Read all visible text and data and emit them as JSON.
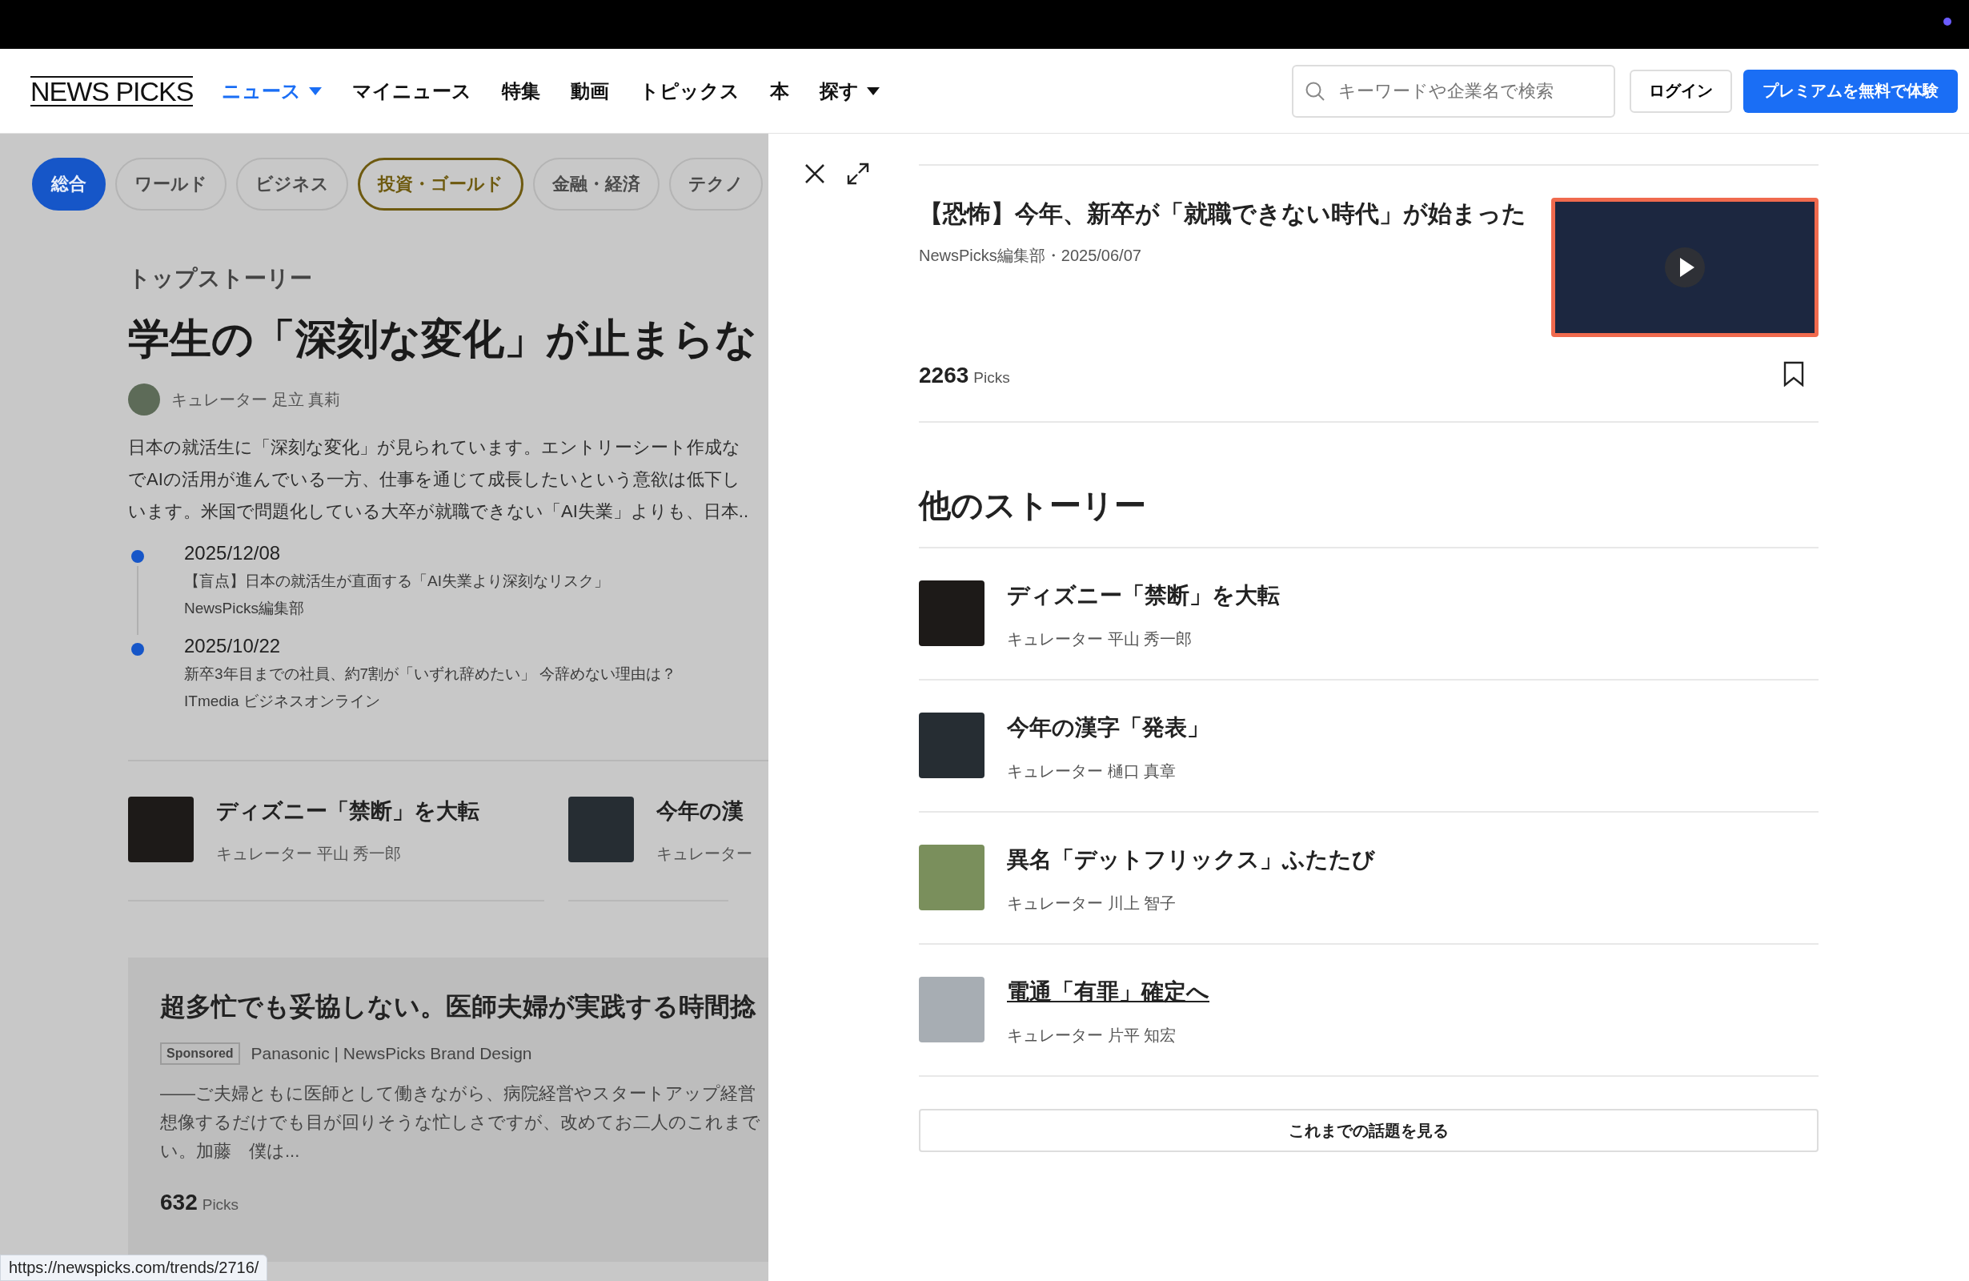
{
  "header": {
    "logo": "NEWS PICKS",
    "nav": [
      {
        "label": "ニュース",
        "selected": true,
        "dropdown": true
      },
      {
        "label": "マイニュース",
        "selected": false,
        "dropdown": false
      },
      {
        "label": "特集",
        "selected": false,
        "dropdown": false
      },
      {
        "label": "動画",
        "selected": false,
        "dropdown": false
      },
      {
        "label": "トピックス",
        "selected": false,
        "dropdown": false
      },
      {
        "label": "本",
        "selected": false,
        "dropdown": false
      },
      {
        "label": "探す",
        "selected": false,
        "dropdown": true
      }
    ],
    "search": {
      "placeholder": "キーワードや企業名で検索"
    },
    "login": "ログイン",
    "premium": "プレミアムを無料で体験"
  },
  "categories": [
    {
      "label": "総合",
      "selected": true,
      "highlighted": false
    },
    {
      "label": "ワールド",
      "selected": false,
      "highlighted": false
    },
    {
      "label": "ビジネス",
      "selected": false,
      "highlighted": false
    },
    {
      "label": "投資・ゴールド",
      "selected": false,
      "highlighted": true
    },
    {
      "label": "金融・経済",
      "selected": false,
      "highlighted": false
    },
    {
      "label": "テクノ",
      "selected": false,
      "highlighted": false
    }
  ],
  "top_story": {
    "section": "トップストーリー",
    "headline": "学生の「深刻な変化」が止まらな",
    "curator": "キュレーター 足立 真莉",
    "lines": [
      "日本の就活生に「深刻な変化」が見られています。エントリーシート作成な",
      "でAIの活用が進んでいる一方、仕事を通じて成長したいという意欲は低下し",
      "います。米国で問題化している大卒が就職できない「AI失業」よりも、日本.."
    ],
    "timeline": [
      {
        "date": "2025/12/08",
        "title": "【盲点】日本の就活生が直面する「AI失業より深刻なリスク」",
        "source": "NewsPicks編集部",
        "faded": false
      },
      {
        "date": "2025/10/22",
        "title": "新卒3年目までの社員、約7割が「いずれ辞めたい」 今辞めない理由は？",
        "source": "ITmedia ビジネスオンライン",
        "faded": false
      }
    ]
  },
  "related": [
    {
      "title": "ディズニー「禁断」を大転",
      "curator": "キュレーター 平山 秀一郎"
    },
    {
      "title": "今年の漢",
      "curator": "キュレーター"
    }
  ],
  "sponsored": {
    "title": "超多忙でも妥協しない。医師夫婦が実践する時間捻",
    "badge": "Sponsored",
    "source": "Panasonic | NewsPicks Brand Design",
    "lines": [
      "——ご夫婦ともに医師として働きながら、病院経営やスタートアップ経営",
      "想像するだけでも目が回りそうな忙しさですが、改めてお二人のこれまで",
      "い。加藤　僕は..."
    ],
    "picks": "632",
    "picks_label": "Picks"
  },
  "status_url": "https://newspicks.com/trends/2716/",
  "panel": {
    "article": {
      "title": "【恐怖】今年、新卒が「就職できない時代」が始まった",
      "meta": "NewsPicks編集部・2025/06/07",
      "picks": "2263",
      "picks_label": "Picks",
      "bookmarked": false
    },
    "other_heading": "他のストーリー",
    "stories": [
      {
        "title": "ディズニー「禁断」を大転",
        "curator": "キュレーター 平山 秀一郎",
        "hovered": false
      },
      {
        "title": "今年の漢字「発表」",
        "curator": "キュレーター 樋口 真章",
        "hovered": false
      },
      {
        "title": "異名「デットフリックス」ふたたび",
        "curator": "キュレーター 川上 智子",
        "hovered": false
      },
      {
        "title": "電通「有罪」確定へ",
        "curator": "キュレーター 片平 知宏",
        "hovered": true
      }
    ],
    "more_button": "これまでの話題を見る"
  }
}
